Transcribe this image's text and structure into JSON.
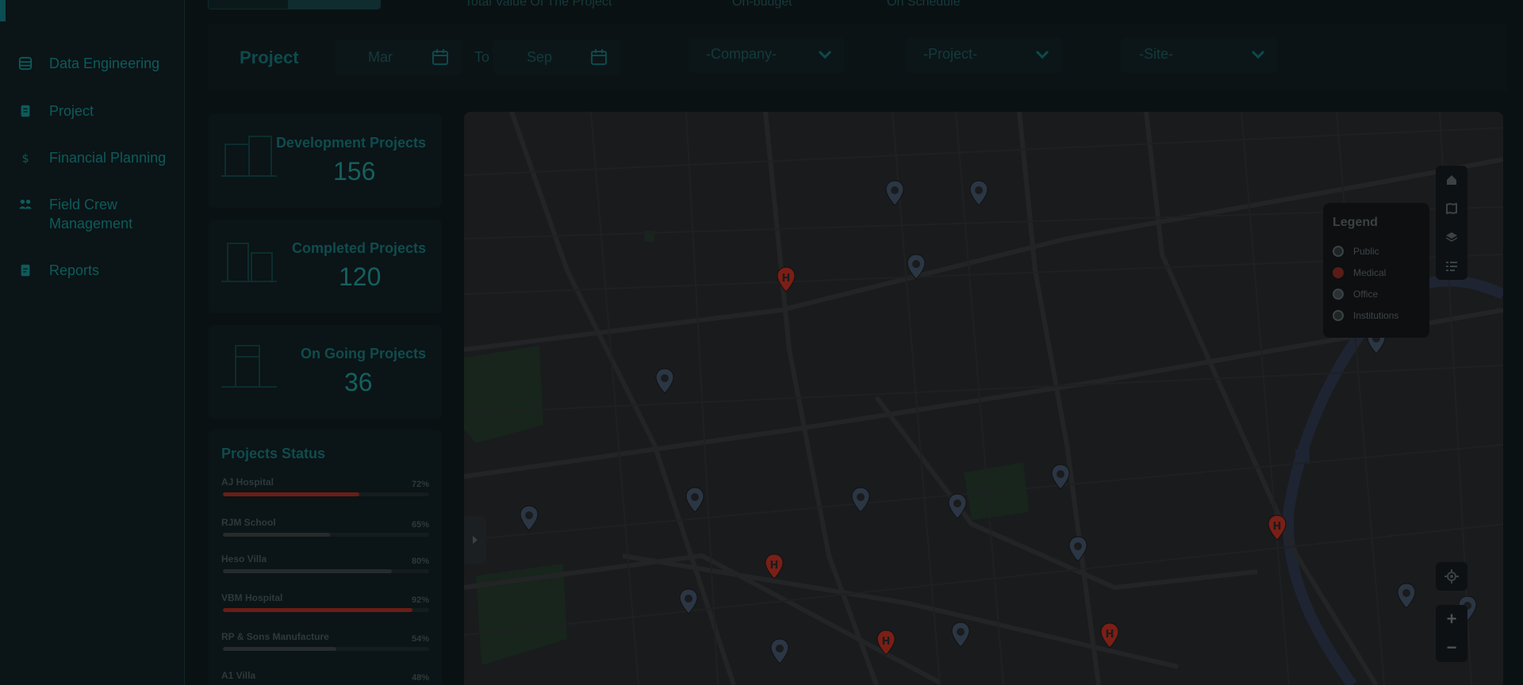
{
  "sidebar": {
    "items": [
      {
        "label": "Data Engineering",
        "icon": "database-icon"
      },
      {
        "label": "Project",
        "icon": "document-icon"
      },
      {
        "label": "Financial Planning",
        "icon": "dollar-icon"
      },
      {
        "label": "Field Crew Management",
        "icon": "people-icon"
      },
      {
        "label": "Reports",
        "icon": "report-icon"
      }
    ]
  },
  "top_strip": {
    "total_value_label": "Total Value Of The Project",
    "on_budget_label": "On-budget",
    "on_schedule_label": "On Schedule"
  },
  "filters": {
    "title": "Project",
    "from_month": "Mar",
    "to_label": "To",
    "to_month": "Sep",
    "company": "-Company-",
    "project": "-Project-",
    "site": "-Site-"
  },
  "stats": [
    {
      "label": "Development Projects",
      "value": "156"
    },
    {
      "label": "Completed Projects",
      "value": "120"
    },
    {
      "label": "On Going Projects",
      "value": "36"
    }
  ],
  "status": {
    "title": "Projects Status",
    "rows": [
      {
        "name": "AJ Hospital",
        "pct": "72%",
        "fraction": 0.66,
        "color": "#6b1d16"
      },
      {
        "name": "RJM School",
        "pct": "65%",
        "fraction": 0.52,
        "color": "#262b2d"
      },
      {
        "name": "Heso Villa",
        "pct": "80%",
        "fraction": 0.82,
        "color": "#262b2d"
      },
      {
        "name": "VBM Hospital",
        "pct": "92%",
        "fraction": 0.92,
        "color": "#6b1d16"
      },
      {
        "name": "RP & Sons Manufacture",
        "pct": "54%",
        "fraction": 0.55,
        "color": "#262b2d"
      },
      {
        "name": "A1 Villa",
        "pct": "48%",
        "fraction": 0.48,
        "color": "#262b2d"
      }
    ]
  },
  "legend": {
    "title": "Legend",
    "items": [
      {
        "label": "Public",
        "color": "#3a4244"
      },
      {
        "label": "Medical",
        "color": "#6b1d16"
      },
      {
        "label": "Office",
        "color": "#3a4244"
      },
      {
        "label": "Institutions",
        "color": "#3a4244"
      }
    ]
  },
  "map_controls": {
    "top": [
      "home-icon",
      "map-icon",
      "layers-icon",
      "list-icon"
    ],
    "locate": "locate-icon",
    "zoom_in": "+",
    "zoom_out": "−"
  },
  "colors": {
    "accent": "#0e4a4c",
    "medical": "#7a1f16",
    "marker": "#2a3a4a"
  }
}
